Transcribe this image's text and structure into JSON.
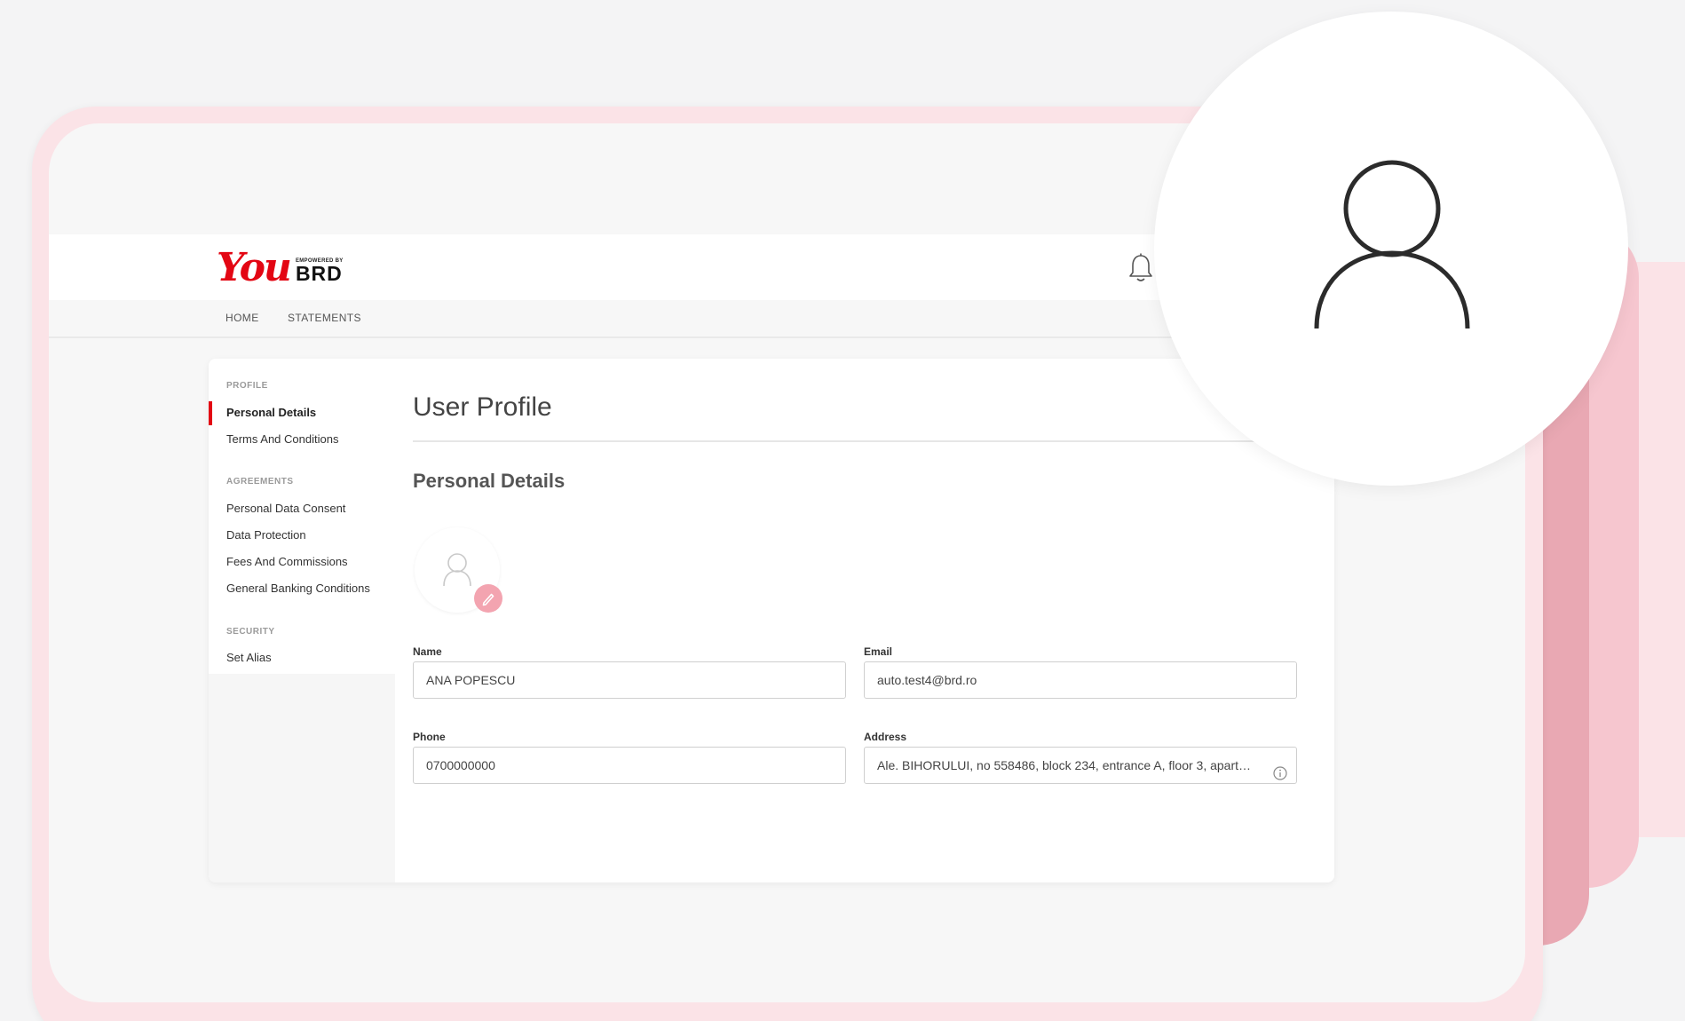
{
  "logo": {
    "brand_main": "You",
    "powered_by": "EMPOWERED BY",
    "brand_bank": "BRD"
  },
  "header": {
    "bell_icon": "bell-icon"
  },
  "nav": {
    "items": [
      {
        "label": "HOME"
      },
      {
        "label": "STATEMENTS"
      }
    ]
  },
  "sidebar": {
    "sections": [
      {
        "title": "PROFILE",
        "items": [
          {
            "label": "Personal Details",
            "active": true
          },
          {
            "label": "Terms And Conditions"
          }
        ]
      },
      {
        "title": "AGREEMENTS",
        "items": [
          {
            "label": "Personal Data Consent"
          },
          {
            "label": "Data Protection"
          },
          {
            "label": "Fees And Commissions"
          },
          {
            "label": "General Banking Conditions"
          }
        ]
      },
      {
        "title": "SECURITY",
        "items": [
          {
            "label": "Set Alias"
          }
        ]
      }
    ]
  },
  "main": {
    "title": "User Profile",
    "section_title": "Personal Details",
    "fields": {
      "name": {
        "label": "Name",
        "value": "ANA POPESCU"
      },
      "email": {
        "label": "Email",
        "value": "auto.test4@brd.ro"
      },
      "phone": {
        "label": "Phone",
        "value": "0700000000"
      },
      "address": {
        "label": "Address",
        "value": "Ale. BIHORULUI, no 558486, block 234, entrance A, floor 3, apart…"
      }
    }
  },
  "colors": {
    "brand_red": "#e30613",
    "accent_pink": "#f3a4b0"
  },
  "icons": {
    "avatar": "user-icon",
    "edit": "pencil-icon",
    "info": "info-icon"
  }
}
